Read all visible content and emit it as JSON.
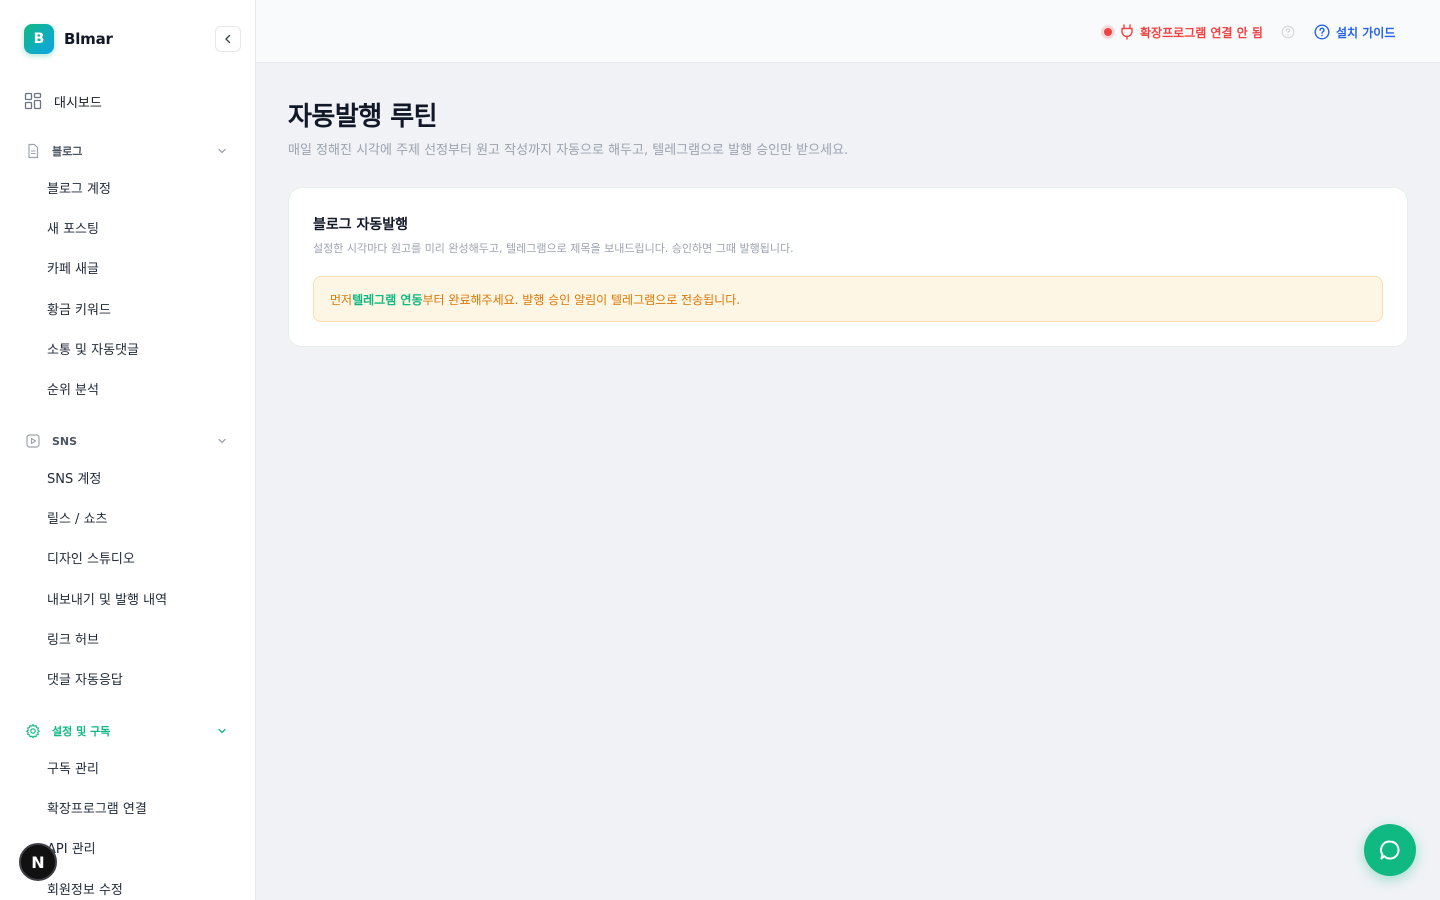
{
  "brand": {
    "logo_letter": "B",
    "name": "Blmar"
  },
  "sidebar": {
    "dashboard_label": "대시보드",
    "groups": [
      {
        "label": "블로그",
        "items": [
          {
            "label": "블로그 계정"
          },
          {
            "label": "새 포스팅"
          },
          {
            "label": "카페 새글"
          },
          {
            "label": "황금 키워드"
          },
          {
            "label": "소통 및 자동댓글"
          },
          {
            "label": "순위 분석"
          }
        ]
      },
      {
        "label": "SNS",
        "items": [
          {
            "label": "SNS 계정"
          },
          {
            "label": "릴스 / 쇼츠"
          },
          {
            "label": "디자인 스튜디오"
          },
          {
            "label": "내보내기 및 발행 내역"
          },
          {
            "label": "링크 허브"
          },
          {
            "label": "댓글 자동응답"
          }
        ]
      },
      {
        "label": "설정 및 구독",
        "items": [
          {
            "label": "구독 관리"
          },
          {
            "label": "확장프로그램 연결"
          },
          {
            "label": "API 관리"
          },
          {
            "label": "회원정보 수정"
          }
        ]
      }
    ]
  },
  "header": {
    "extension_status": "확장프로그램 연결 안 됨",
    "guide_label": "설치 가이드"
  },
  "main": {
    "title": "자동발행 루틴",
    "subtitle": "매일 정해진 시각에 주제 선정부터 원고 작성까지 자동으로 해두고, 텔레그램으로 발행 승인만 받으세요.",
    "card": {
      "title": "블로그 자동발행",
      "description": "설정한 시각마다 원고를 미리 완성해두고, 텔레그램으로 제목을 보내드립니다. 승인하면 그때 발행됩니다.",
      "notice_prefix": "먼저 ",
      "notice_link": "텔레그램 연동",
      "notice_suffix": "부터 완료해주세요. 발행 승인 알림이 텔레그램으로 전송됩니다."
    }
  },
  "next_badge": "N",
  "colors": {
    "accent": "#10b981",
    "danger": "#ef4444",
    "link": "#2563eb",
    "warning": "#d97706"
  }
}
